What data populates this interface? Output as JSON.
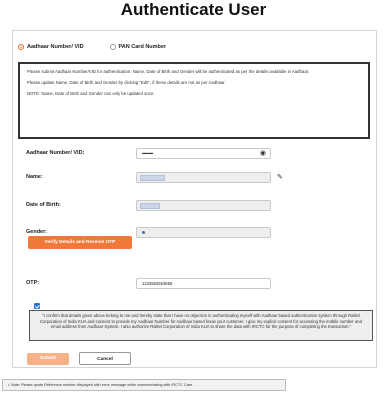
{
  "page": {
    "title": "Authenticate User"
  },
  "id_type": {
    "options": [
      {
        "label": "Aadhaar Number/ VID",
        "selected": true
      },
      {
        "label": "PAN Card Number",
        "selected": false
      }
    ]
  },
  "notice": {
    "lines": [
      "Please submit Aadhaar Number/VID for authentication. Name, Date of Birth and Gender will be authenticated as per the details available in Aadhaar.",
      "Please update Name, Date of Birth and Gender by clicking \"Edit\", if these details are not as per Aadhaar.",
      "NOTE: Name, Date of Birth and Gender can only be updated once."
    ]
  },
  "form": {
    "aadhaar_label": "Aadhaar Number/ VID:",
    "aadhaar_value": "••••••••••",
    "name_label": "Name:",
    "dob_label": "Date of Birth:",
    "gender_label": "Gender:",
    "verify_button": "Verify Details and Receive OTP",
    "otp_label": "OTP:",
    "otp_value": "1234562563659"
  },
  "consent": {
    "checked": true,
    "text": "\"I confirm that details given above belong to me and hereby state that I have no objection in authenticating myself with Aadhaar based authentication system through Railtel Corporation of India KUA and consent to provide my Aadhaar Number for Aadhaar based know your customer. I give my explicit consent for accessing the mobile number and email address from Aadhaar System. I also authorize Railtel Corporation of India KUA to share the data with IRCTC for the purpose of completing the transaction.\""
  },
  "actions": {
    "submit": "Submit",
    "cancel": "Cancel"
  },
  "footnote": "i. Note: Please quote Reference number displayed with error message while communicating with IRCTC Care.",
  "colors": {
    "accent": "#f0793a",
    "accent_disabled": "#f7b28a",
    "checkbox": "#2a7ad9"
  }
}
